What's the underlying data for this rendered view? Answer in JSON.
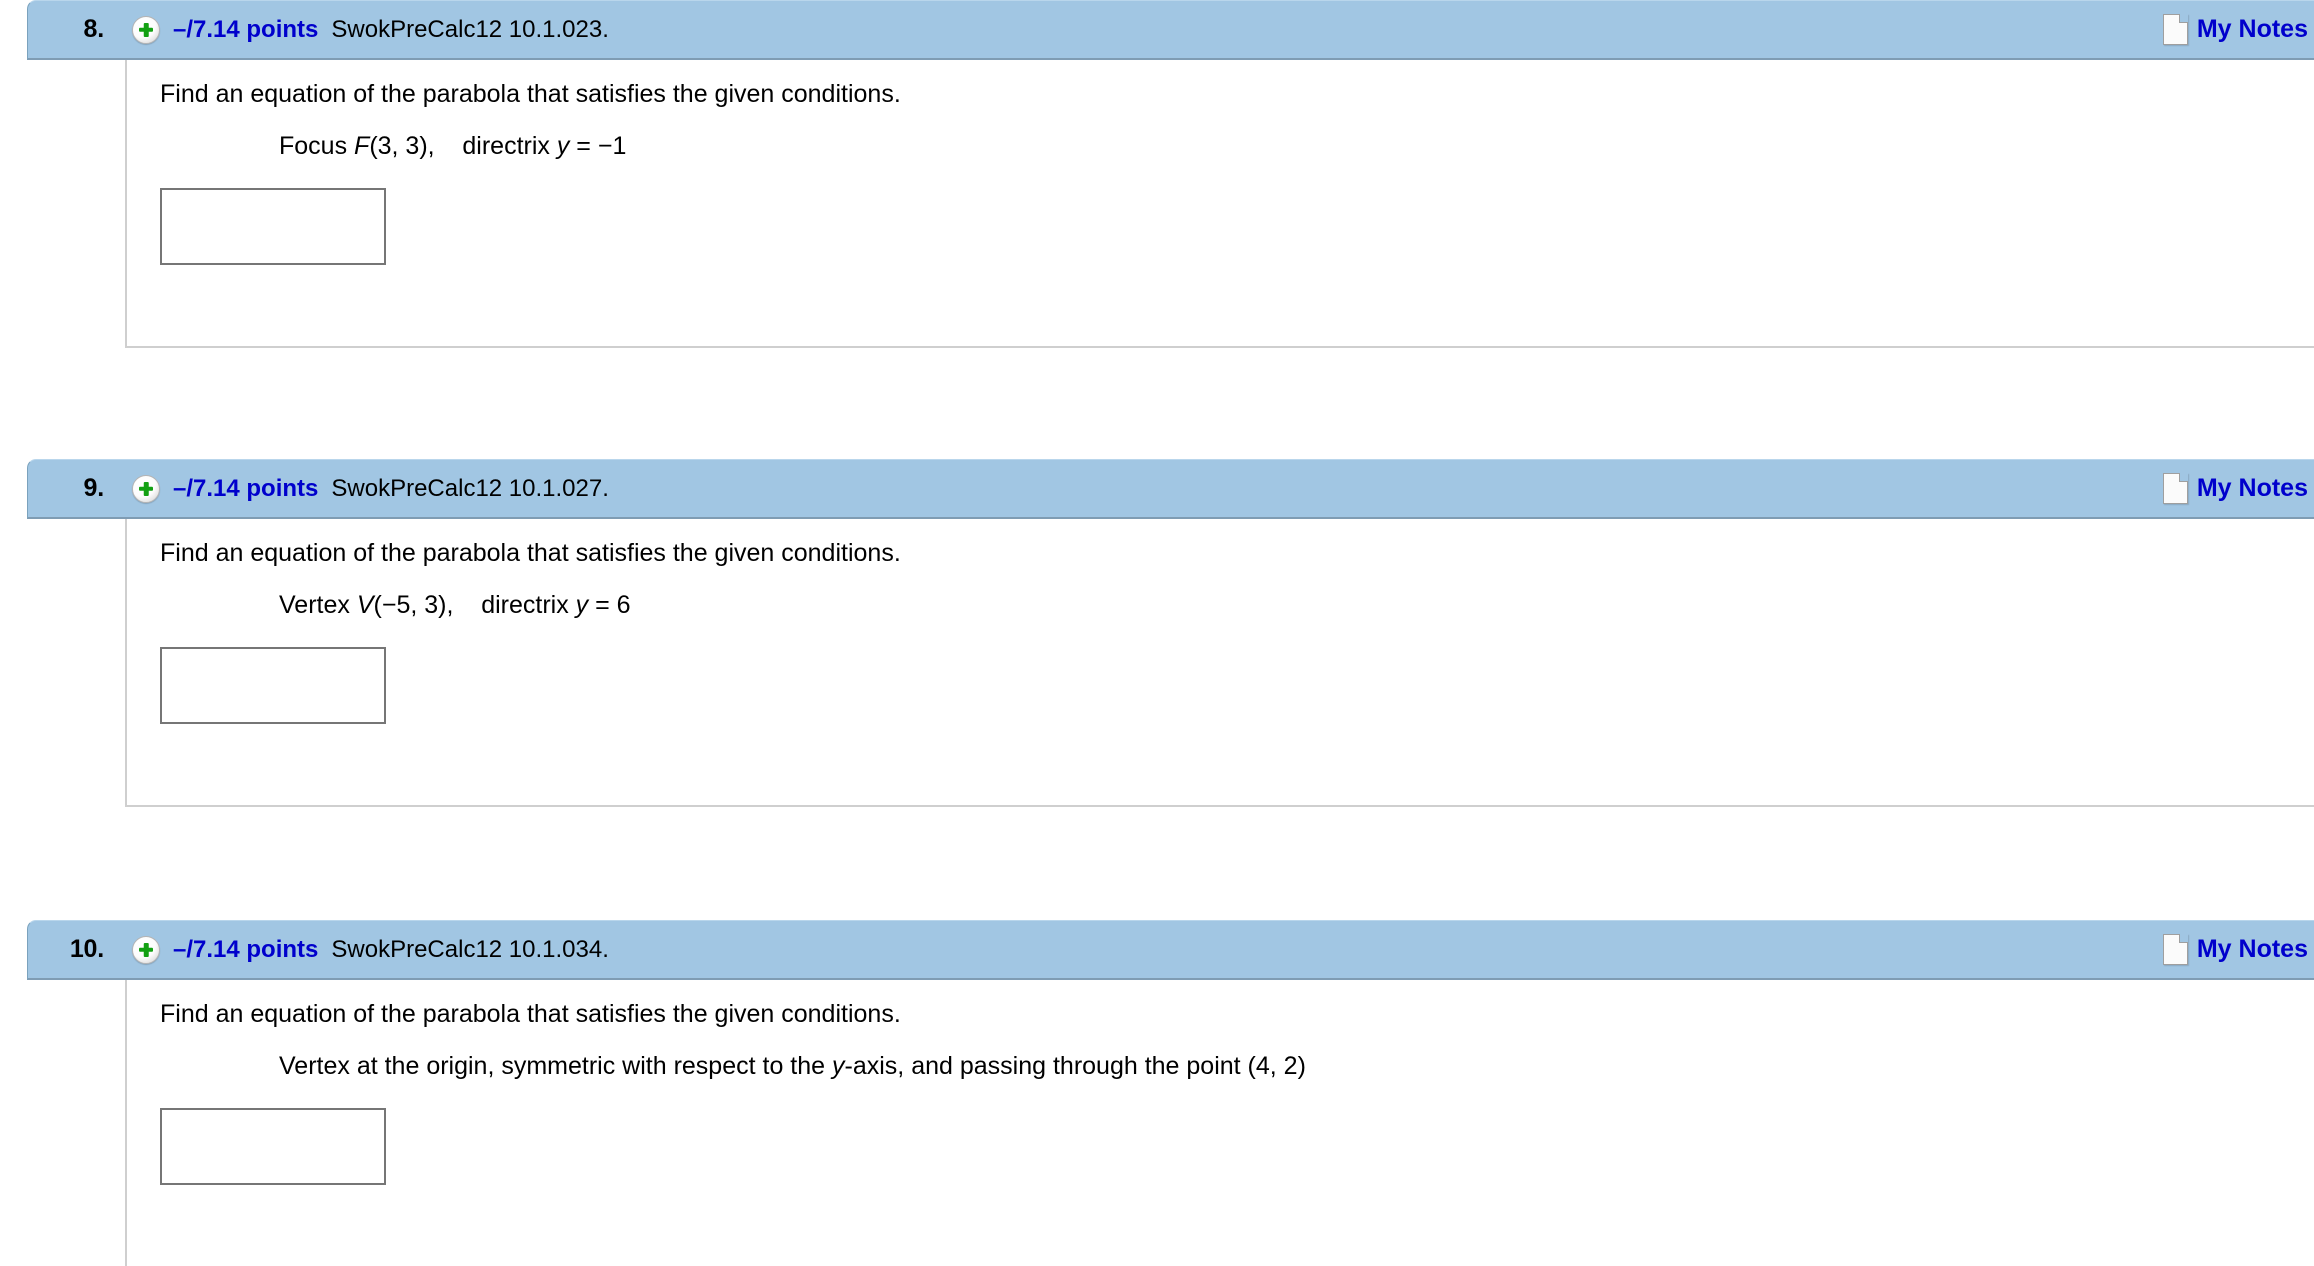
{
  "page": {
    "background_color": "#ffffff",
    "header_bar_color": "#a1c6e3",
    "link_color": "#0000cc",
    "divider_color": "#cfcfcf"
  },
  "questions": [
    {
      "number": "8.",
      "expand_icon": "plus-circle-icon",
      "points": "–/7.14 points",
      "reference": "SwokPreCalc12 10.1.023.",
      "notes_icon": "note-page-icon",
      "notes_label": "My Notes",
      "prompt": "Find an equation of the parabola that satisfies the given conditions.",
      "condition_prefix": "Focus ",
      "condition_var": "F",
      "condition_mid": "(3, 3),    directrix ",
      "condition_var2": "y",
      "condition_suffix": " = −1",
      "answer_value": "",
      "answer_placeholder": ""
    },
    {
      "number": "9.",
      "expand_icon": "plus-circle-icon",
      "points": "–/7.14 points",
      "reference": "SwokPreCalc12 10.1.027.",
      "notes_icon": "note-page-icon",
      "notes_label": "My Notes",
      "prompt": "Find an equation of the parabola that satisfies the given conditions.",
      "condition_prefix": "Vertex ",
      "condition_var": "V",
      "condition_mid": "(−5, 3),    directrix ",
      "condition_var2": "y",
      "condition_suffix": " = 6",
      "answer_value": "",
      "answer_placeholder": ""
    },
    {
      "number": "10.",
      "expand_icon": "plus-circle-icon",
      "points": "–/7.14 points",
      "reference": "SwokPreCalc12 10.1.034.",
      "notes_icon": "note-page-icon",
      "notes_label": "My Notes",
      "prompt": "Find an equation of the parabola that satisfies the given conditions.",
      "condition_prefix": "Vertex at the origin, symmetric with respect to the ",
      "condition_var": "y",
      "condition_mid": "-axis, and passing through the point (4, 2)",
      "condition_var2": "",
      "condition_suffix": "",
      "answer_value": "",
      "answer_placeholder": ""
    }
  ]
}
